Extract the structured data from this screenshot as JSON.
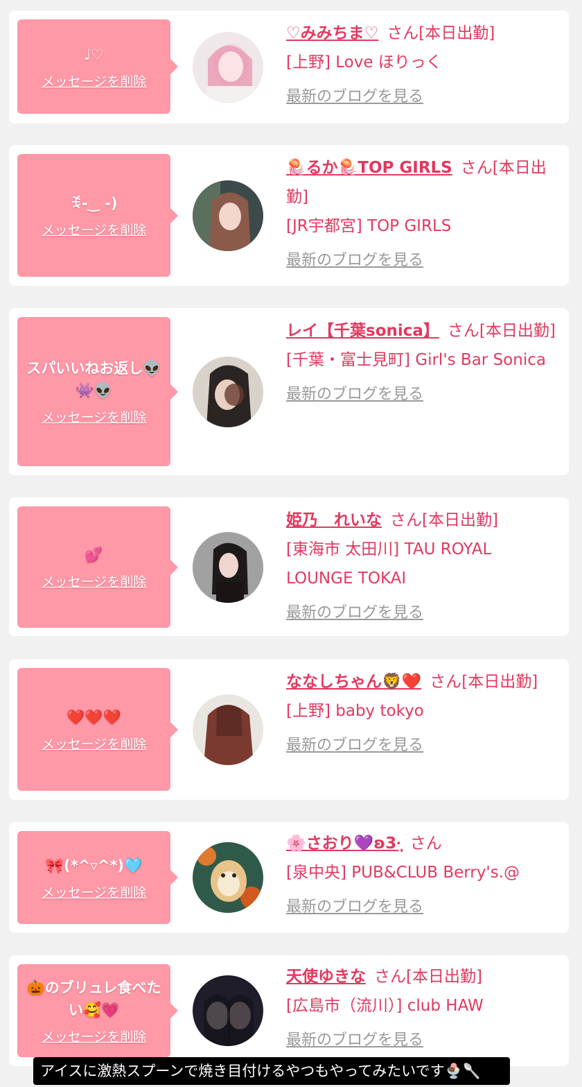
{
  "delete_label": "メッセージを削除",
  "blog_label": "最新のブログを見る",
  "subtitle": "アイスに激熱スプーンで焼き目付けるやつもやってみたいです🍨🥄",
  "cards": [
    {
      "message": "♩♡",
      "name": "♡みみちま♡",
      "suffix": "さん[本日出勤]",
      "shop": "[上野] Love ほりっく"
    },
    {
      "message": "ꉂ-‿ -)",
      "name": "🪼るか🪼TOP GIRLS",
      "suffix": "さん[本日出勤]",
      "shop": "[JR宇都宮] TOP GIRLS"
    },
    {
      "message": "スパいいねお返し👽👾👽",
      "name": "レイ【千葉sonica】",
      "suffix": "さん[本日出勤]",
      "shop": "[千葉・富士見町] Girl's Bar Sonica"
    },
    {
      "message": "💕",
      "name": "姫乃　れいな",
      "suffix": "さん[本日出勤]",
      "shop": "[東海市 太田川] TAU ROYAL LOUNGE TOKAI"
    },
    {
      "message": "❤️❤️❤️",
      "name": "ななしちゃん🦁❤️",
      "suffix": "さん[本日出勤]",
      "shop": "[上野] baby tokyo"
    },
    {
      "message": "🎀(*^▿^*)🩵",
      "name": "🌸さおり💜ʚ3·̩͙",
      "suffix": "さん",
      "shop": "[泉中央] PUB&CLUB Berry's.@"
    },
    {
      "message": "🎃のブリュレ食べたい🥰💗",
      "name": "天使ゆきな",
      "suffix": "さん[本日出勤]",
      "shop": "[広島市（流川）] club HAW"
    }
  ]
}
